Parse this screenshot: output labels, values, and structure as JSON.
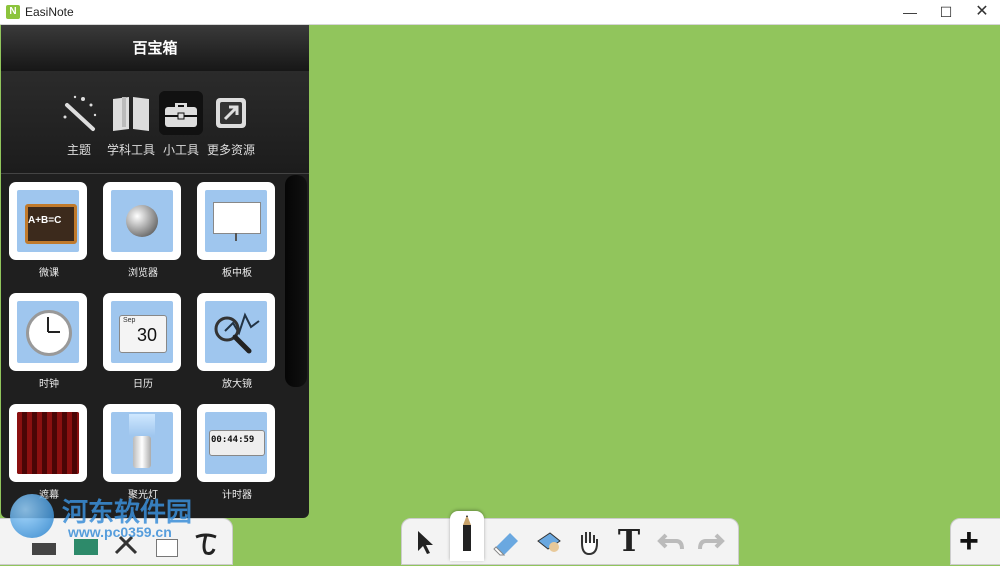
{
  "window": {
    "title": "EasiNote",
    "icon_letter": "N",
    "minimize": "—",
    "maximize": "☐",
    "close": "✕"
  },
  "panel": {
    "title": "百宝箱",
    "categories": [
      {
        "label": "主题",
        "icon": "magic-wand-icon"
      },
      {
        "label": "学科工具",
        "icon": "book-icon"
      },
      {
        "label": "小工具",
        "icon": "toolbox-icon",
        "active": true
      },
      {
        "label": "更多资源",
        "icon": "external-link-icon"
      }
    ],
    "tools": [
      {
        "label": "微课",
        "icon": "blackboard-icon",
        "tile_text": "A+B=C"
      },
      {
        "label": "浏览器",
        "icon": "globe-icon"
      },
      {
        "label": "板中板",
        "icon": "whiteboard-icon"
      },
      {
        "label": "时钟",
        "icon": "clock-icon"
      },
      {
        "label": "日历",
        "icon": "calendar-icon",
        "month": "Sep",
        "day": "30"
      },
      {
        "label": "放大镜",
        "icon": "magnifier-icon"
      },
      {
        "label": "遮幕",
        "icon": "curtain-icon"
      },
      {
        "label": "聚光灯",
        "icon": "flashlight-icon"
      },
      {
        "label": "计时器",
        "icon": "timer-icon",
        "display": "00:44:59"
      }
    ]
  },
  "bottom_toolbar": {
    "tools": [
      "select-arrow-icon",
      "pen-icon",
      "eraser-icon",
      "lasso-icon",
      "hand-icon",
      "text-icon",
      "undo-icon",
      "redo-icon"
    ],
    "text_tool_glyph": "T",
    "add_glyph": "+"
  },
  "watermark": {
    "text": "河东软件园",
    "url": "www.pc0359.cn"
  },
  "colors": {
    "canvas": "#91c55c",
    "panel": "#1f1f1f",
    "tile_bg": "#9fc6ee"
  }
}
